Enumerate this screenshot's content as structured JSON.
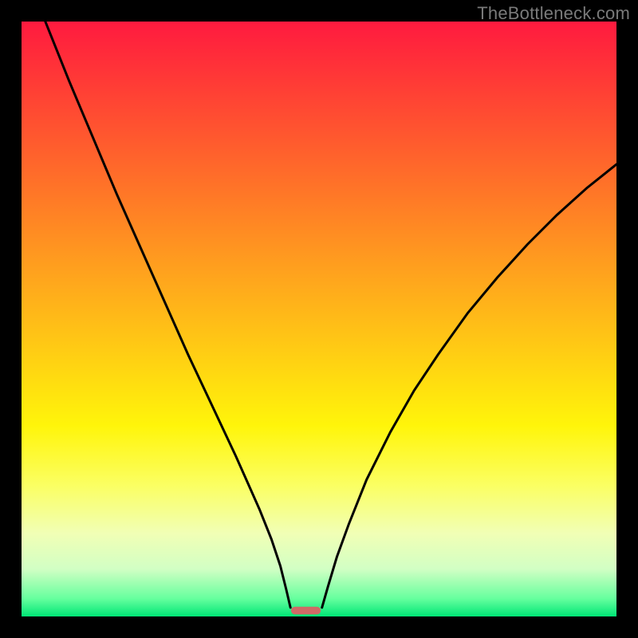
{
  "watermark": "TheBottleneck.com",
  "colors": {
    "frame": "#000000",
    "curve": "#000000",
    "marker_fill": "#cf6a66",
    "gradient_stops": [
      {
        "offset": 0.0,
        "color": "#ff1a3f"
      },
      {
        "offset": 0.1,
        "color": "#ff3a36"
      },
      {
        "offset": 0.25,
        "color": "#ff6a2a"
      },
      {
        "offset": 0.4,
        "color": "#ff9b1f"
      },
      {
        "offset": 0.55,
        "color": "#ffcb14"
      },
      {
        "offset": 0.68,
        "color": "#fff50a"
      },
      {
        "offset": 0.78,
        "color": "#fbff63"
      },
      {
        "offset": 0.86,
        "color": "#f1ffb5"
      },
      {
        "offset": 0.92,
        "color": "#d2ffc4"
      },
      {
        "offset": 0.97,
        "color": "#66ff9e"
      },
      {
        "offset": 1.0,
        "color": "#00e676"
      }
    ]
  },
  "chart_data": {
    "type": "line",
    "title": "",
    "xlabel": "",
    "ylabel": "",
    "xlim": [
      0,
      100
    ],
    "ylim": [
      0,
      100
    ],
    "grid": false,
    "legend": false,
    "series": [
      {
        "name": "left-curve",
        "x": [
          4,
          8,
          12,
          16,
          20,
          24,
          28,
          32,
          36,
          38,
          40,
          42,
          43.5,
          44.5,
          45.2
        ],
        "y": [
          100,
          90,
          80.5,
          71,
          62,
          53,
          44,
          35.5,
          27,
          22.5,
          18,
          13,
          8.5,
          4.5,
          1.5
        ]
      },
      {
        "name": "right-curve",
        "x": [
          50.5,
          51.5,
          53,
          55,
          58,
          62,
          66,
          70,
          75,
          80,
          85,
          90,
          95,
          100
        ],
        "y": [
          1.5,
          5,
          10,
          15.5,
          23,
          31,
          38,
          44,
          51,
          57,
          62.5,
          67.5,
          72,
          76
        ]
      }
    ],
    "marker": {
      "x": 47.8,
      "y": 1.0,
      "w": 5.0,
      "h": 1.3
    }
  }
}
